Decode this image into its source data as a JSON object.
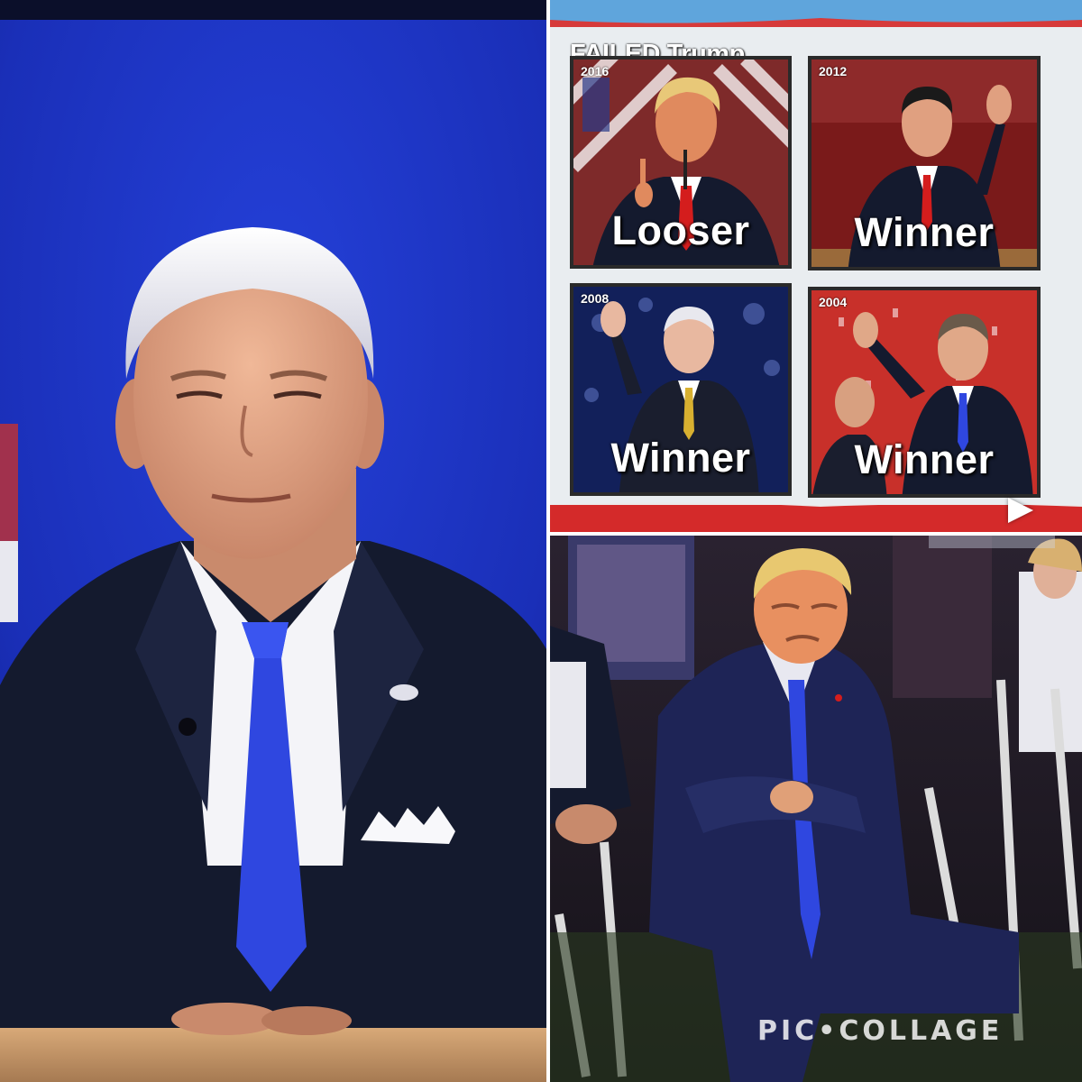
{
  "collage": {
    "board": {
      "title": "FAILED Trump",
      "tiles": [
        {
          "year": "2016",
          "label": "Looser"
        },
        {
          "year": "2012",
          "label": "Winner"
        },
        {
          "year": "2008",
          "label": "Winner"
        },
        {
          "year": "2004",
          "label": "Winner"
        }
      ]
    },
    "watermark": "PIC•COLLAGE"
  },
  "colors": {
    "stage_blue": "#1a2fc9",
    "suit_navy": "#141a2e",
    "tie_blue": "#2f47e0",
    "tie_red": "#d41d1d",
    "banner_red": "#d42a2a"
  }
}
